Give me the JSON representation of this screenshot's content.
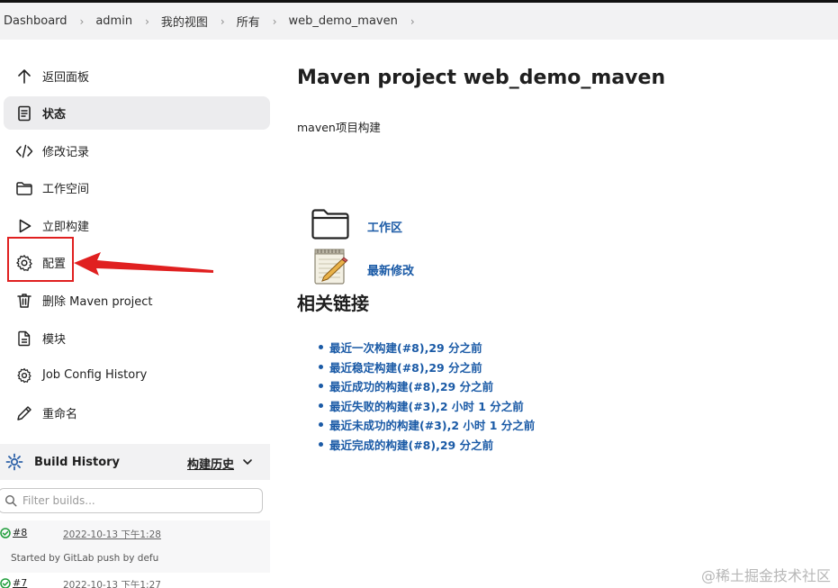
{
  "breadcrumb": [
    "Dashboard",
    "admin",
    "我的视图",
    "所有",
    "web_demo_maven"
  ],
  "sidebar": {
    "items": [
      {
        "label": "返回面板",
        "icon": "arrow-up-icon"
      },
      {
        "label": "状态",
        "icon": "document-icon"
      },
      {
        "label": "修改记录",
        "icon": "code-icon"
      },
      {
        "label": "工作空间",
        "icon": "folder-icon"
      },
      {
        "label": "立即构建",
        "icon": "play-icon"
      },
      {
        "label": "配置",
        "icon": "gear-icon"
      },
      {
        "label": "删除 Maven project",
        "icon": "trash-icon"
      },
      {
        "label": "模块",
        "icon": "file-icon"
      },
      {
        "label": "Job Config History",
        "icon": "history-icon"
      },
      {
        "label": "重命名",
        "icon": "pencil-icon"
      }
    ]
  },
  "build_history": {
    "title": "Build History",
    "trend_label": "构建历史",
    "filter_placeholder": "Filter builds...",
    "builds": [
      {
        "number": "#8",
        "date": "2022-10-13 下午1:28",
        "cause": "Started by GitLab push by defu"
      },
      {
        "number": "#7",
        "date": "2022-10-13 下午1:27"
      }
    ]
  },
  "main": {
    "title": "Maven project web_demo_maven",
    "description": "maven项目构建",
    "links": [
      {
        "label": "工作区",
        "icon": "folder-icon"
      },
      {
        "label": "最新修改",
        "icon": "notepad-icon"
      }
    ],
    "related_title": "相关链接",
    "related_links": [
      "最近一次构建(#8),29 分之前",
      "最近稳定构建(#8),29 分之前",
      "最近成功的构建(#8),29 分之前",
      "最近失败的构建(#3),2 小时 1 分之前",
      "最近未成功的构建(#3),2 小时 1 分之前",
      "最近完成的构建(#8),29 分之前"
    ]
  },
  "watermark": "@稀土掘金技术社区",
  "colors": {
    "link": "#1a5aa6",
    "annotation": "#e02020",
    "success": "#1f9d3a"
  }
}
